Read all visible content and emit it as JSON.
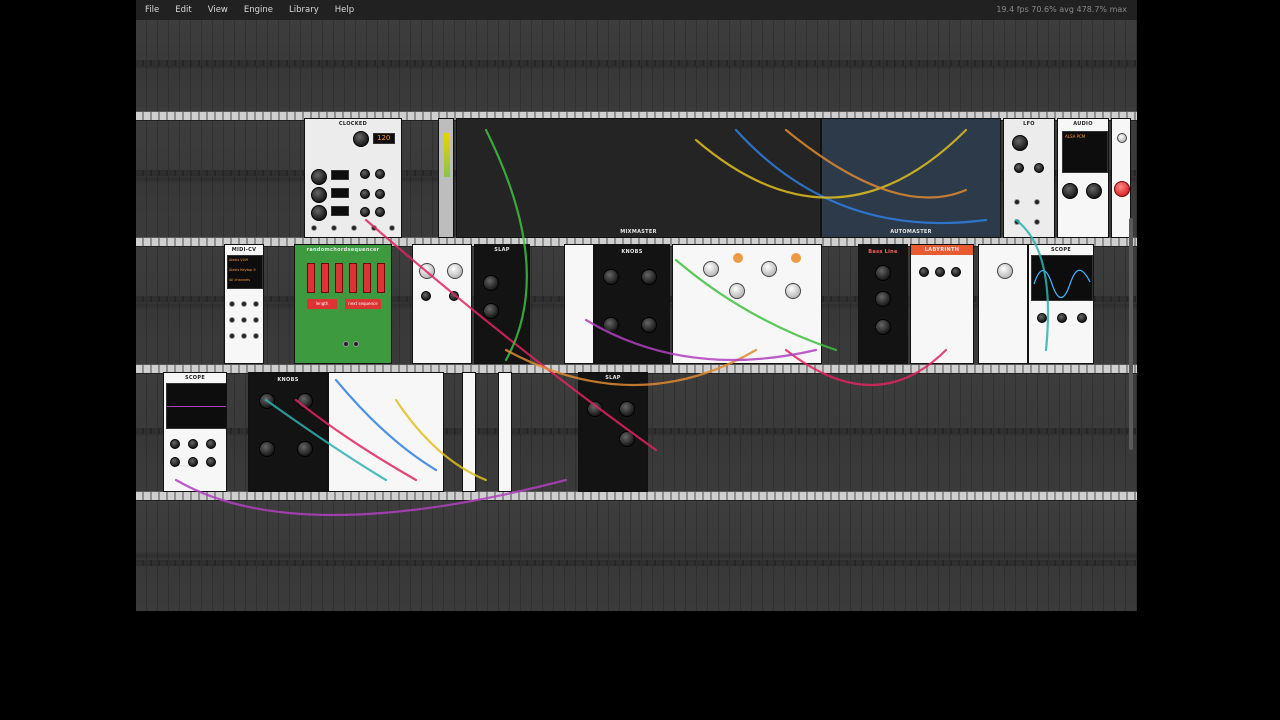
{
  "menu": {
    "items": [
      "File",
      "Edit",
      "View",
      "Engine",
      "Library",
      "Help"
    ]
  },
  "perf": {
    "text": "19.4 fps  70.6% avg  478.7% max"
  },
  "modules": {
    "clocked_title": "CLOCKED",
    "clocked_bpm": "120",
    "midi_cv_title": "MIDI-CV",
    "midi_cv_lines": [
      "Alesis VI49",
      "Alesis Keytop II",
      "All channels"
    ],
    "randomchords_title": "randomchordsequencer",
    "randomchords_buttons": [
      "length",
      "next sequence"
    ],
    "mixmaster_title": "MIXMASTER",
    "automaster_title": "AUTOMASTER",
    "slap_title": "SLAP",
    "knobs_title": "KNOBS",
    "scope_title": "SCOPE",
    "audio_title": "AUDIO",
    "audio_device": "ALSA PCM",
    "lfo_title": "LFO",
    "bassline_title": "Bass Line",
    "sampledelays_title": "LABYRINTH"
  },
  "colors": {
    "cable_red": "#e0245e",
    "cable_green": "#3fbf3f",
    "cable_blue": "#2f7fe0",
    "cable_yellow": "#e0c020",
    "cable_purple": "#b040c0",
    "cable_orange": "#e08a30",
    "cable_teal": "#30b0b0"
  }
}
